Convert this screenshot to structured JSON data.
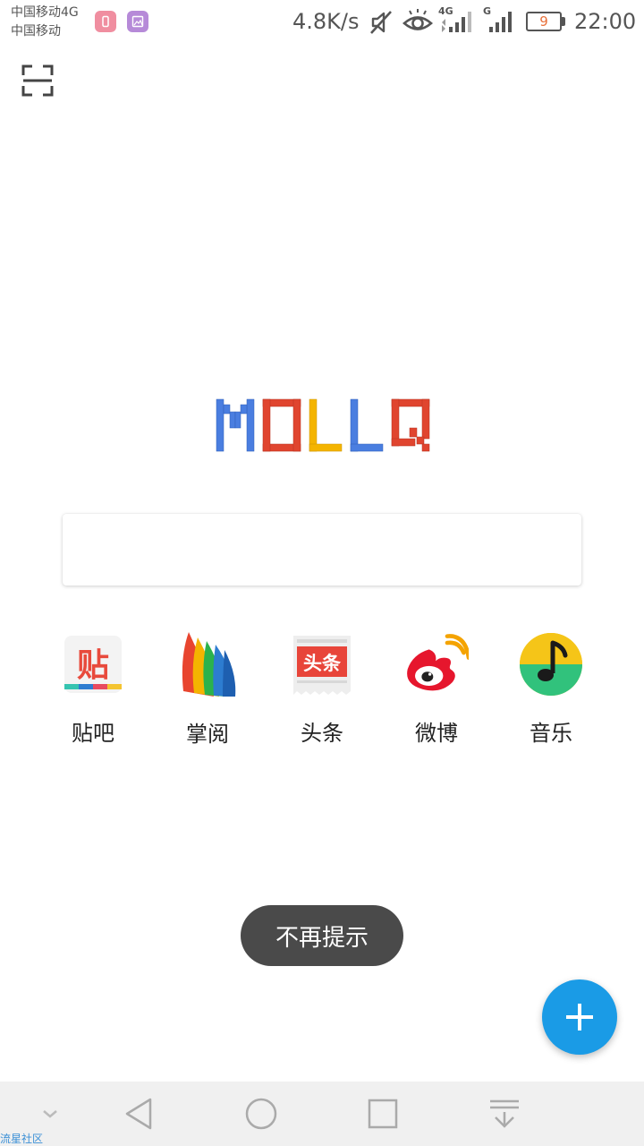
{
  "status_bar": {
    "carrier_1": "中国移动4G",
    "carrier_2": "中国移动",
    "net_speed": "4.8K/s",
    "network_1": "4G",
    "network_2": "G",
    "battery_level": "9",
    "time": "22:00",
    "icons": [
      "notification-app-icon",
      "notification-gallery-icon",
      "mute-icon",
      "eye-icon",
      "signal-4g-icon",
      "signal-g-icon",
      "battery-icon"
    ]
  },
  "logo": {
    "letters": [
      "M",
      "O",
      "L",
      "L",
      "Q"
    ],
    "colors": [
      "#4a7ee0",
      "#e0452f",
      "#f4b400",
      "#4a7ee0",
      "#e0452f"
    ]
  },
  "search": {
    "value": "",
    "placeholder": ""
  },
  "shortcuts": [
    {
      "label": "贴吧",
      "icon": "tieba-icon",
      "icon_text": "贴"
    },
    {
      "label": "掌阅",
      "icon": "zhangyue-icon"
    },
    {
      "label": "头条",
      "icon": "toutiao-icon",
      "icon_text": "头条"
    },
    {
      "label": "微博",
      "icon": "weibo-icon"
    },
    {
      "label": "音乐",
      "icon": "music-icon"
    }
  ],
  "toast": {
    "text": "不再提示"
  },
  "fab": {
    "icon": "plus-icon",
    "color": "#1a9be6"
  },
  "nav_bar": {
    "icons": [
      "chevron-down-icon",
      "back-icon",
      "home-icon",
      "recents-icon",
      "notification-pulldown-icon"
    ]
  },
  "watermark": {
    "text": "流星社区"
  }
}
